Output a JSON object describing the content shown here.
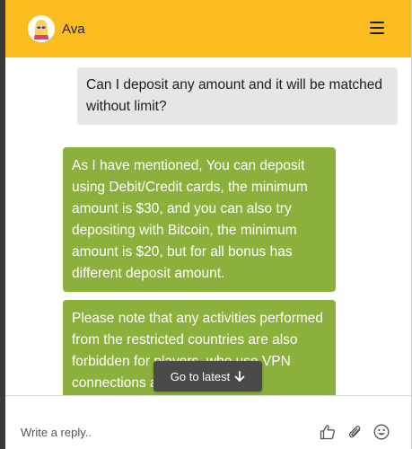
{
  "header": {
    "bot_name": "Ava",
    "avatar_icon": "woman-avatar-icon",
    "menu_icon": "hamburger-menu-icon",
    "background_color": "#fbbc1f"
  },
  "messages": [
    {
      "from": "user",
      "text": "Can I deposit any amount and it will be matched without limit?"
    },
    {
      "from": "bot",
      "text": "As I have mentioned, You can deposit using Debit/Credit cards, the minimum amount is $30, and you can also try depositing with Bitcoin, the minimum amount is $20, but for all bonus has different deposit amount."
    },
    {
      "from": "bot",
      "text": "Please note that any activities performed from the restricted countries are also forbidden for players, who use VPN connections a that helps"
    }
  ],
  "go_latest": {
    "label": "Go to latest",
    "icon": "arrow-down-icon"
  },
  "composer": {
    "placeholder": "Write a reply..",
    "icons": [
      "thumbs-up-icon",
      "paperclip-icon",
      "smiley-icon"
    ]
  },
  "colors": {
    "bot_bubble": "#8cb03c",
    "user_bubble": "#e6e6e6"
  }
}
